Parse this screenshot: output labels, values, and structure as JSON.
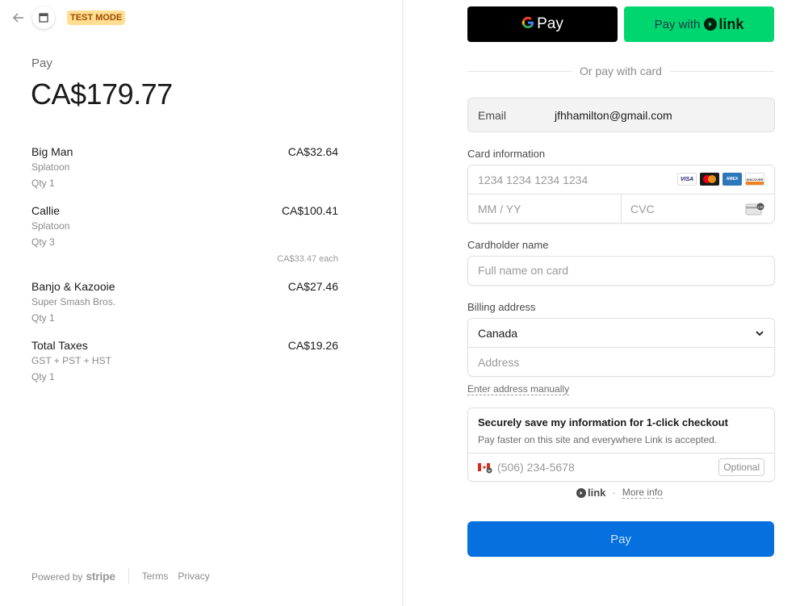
{
  "header": {
    "test_mode_badge": "TEST MODE"
  },
  "summary": {
    "pay_label": "Pay",
    "amount": "CA$179.77",
    "items": [
      {
        "name": "Big Man",
        "sub": "Splatoon",
        "qty": "Qty 1",
        "price": "CA$32.64",
        "each": ""
      },
      {
        "name": "Callie",
        "sub": "Splatoon",
        "qty": "Qty 3",
        "price": "CA$100.41",
        "each": "CA$33.47 each"
      },
      {
        "name": "Banjo & Kazooie",
        "sub": "Super Smash Bros.",
        "qty": "Qty 1",
        "price": "CA$27.46",
        "each": ""
      },
      {
        "name": "Total Taxes",
        "sub": "GST + PST + HST",
        "qty": "Qty 1",
        "price": "CA$19.26",
        "each": ""
      }
    ]
  },
  "footer": {
    "powered_by": "Powered by",
    "brand": "stripe",
    "terms": "Terms",
    "privacy": "Privacy"
  },
  "wallets": {
    "gpay_label": "Pay",
    "link_prefix": "Pay with",
    "link_word": "link"
  },
  "form": {
    "or_text": "Or pay with card",
    "email_label": "Email",
    "email_value": "jfhhamilton@gmail.com",
    "card_label": "Card information",
    "card_number_placeholder": "1234 1234 1234 1234",
    "expiry_placeholder": "MM / YY",
    "cvc_placeholder": "CVC",
    "card_brands": [
      "VISA",
      "Mastercard",
      "AMEX",
      "DISCOVER"
    ],
    "cardholder_label": "Cardholder name",
    "cardholder_placeholder": "Full name on card",
    "billing_label": "Billing address",
    "country": "Canada",
    "address_placeholder": "Address",
    "manual_link": "Enter address manually"
  },
  "save": {
    "title": "Securely save my information for 1-click checkout",
    "subtitle": "Pay faster on this site and everywhere Link is accepted.",
    "phone_placeholder": "(506) 234-5678",
    "optional": "Optional"
  },
  "link_footer": {
    "link_word": "link",
    "separator": "·",
    "more_info": "More info"
  },
  "pay_button": "Pay",
  "colors": {
    "pay_button_bg": "#0570de",
    "link_green": "#00d66f",
    "test_mode_bg": "#ffde92"
  }
}
